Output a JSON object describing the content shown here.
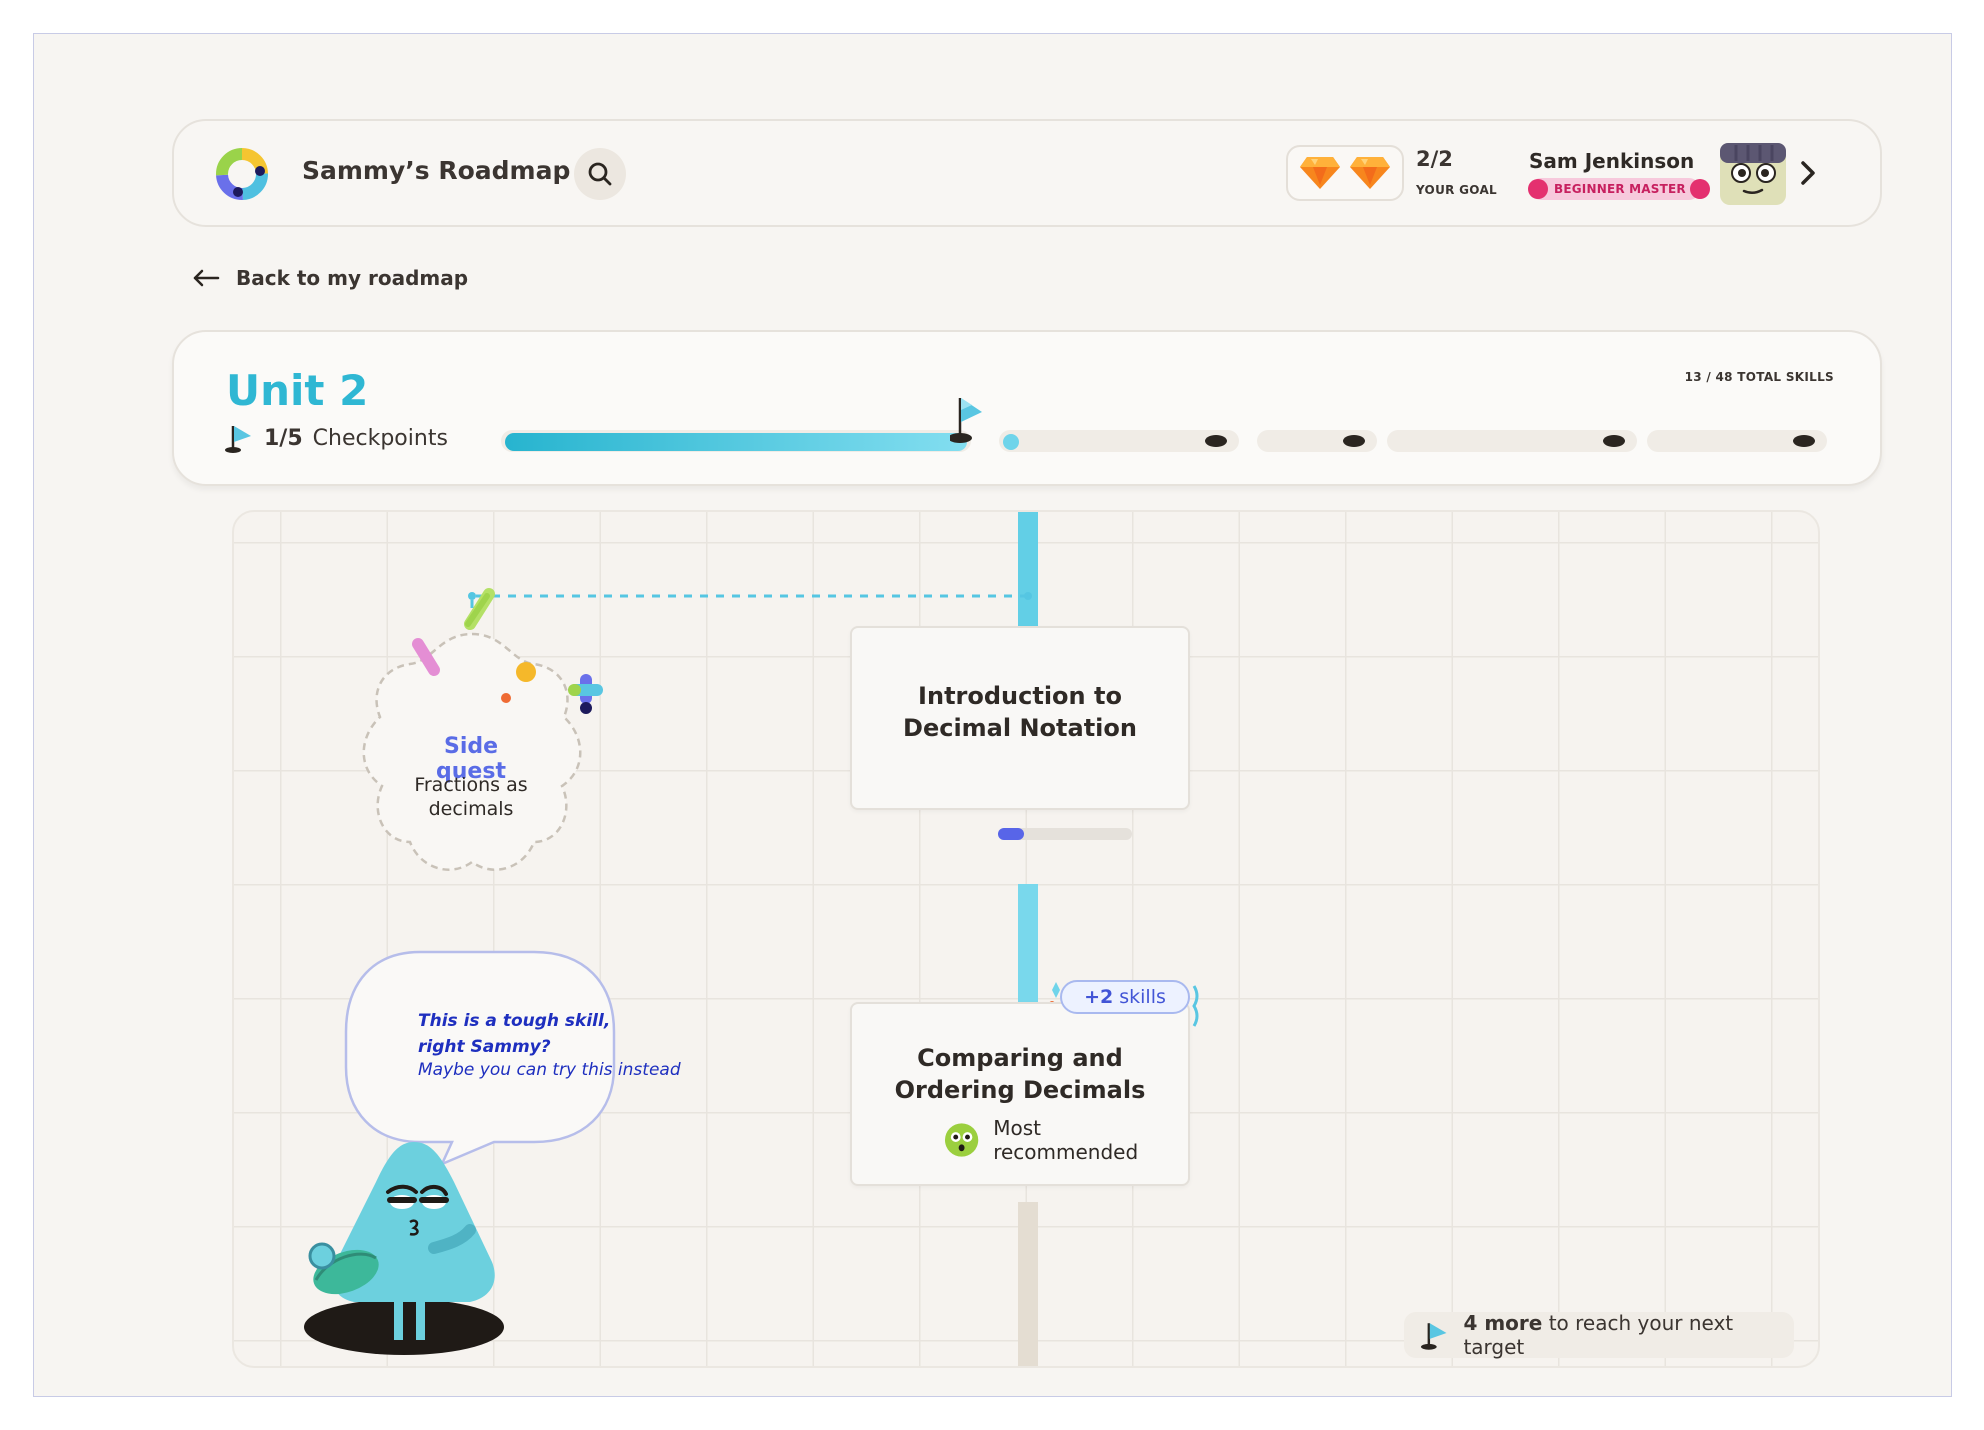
{
  "header": {
    "app_title": "Sammy’s Roadmap",
    "goal_count": "2/2",
    "goal_label": "YOUR GOAL",
    "user_name": "Sam Jenkinson",
    "rank_badge": "BEGINNER MASTER"
  },
  "nav": {
    "back_label": "Back to my roadmap"
  },
  "unit": {
    "title": "Unit 2",
    "checkpoints_count": "1/5",
    "checkpoints_label": "Checkpoints",
    "total_skills": "13 / 48 TOTAL SKILLS",
    "progress_fraction": 0.2
  },
  "map": {
    "side_quest": {
      "title": "Side quest",
      "subtitle": "Fractions as decimals"
    },
    "cards": [
      {
        "title": "Introduction to Decimal Notation",
        "progress_fraction": 0.2
      },
      {
        "title": "Comparing and Ordering Decimals",
        "badge": "Most recommended"
      }
    ],
    "extra_skills": {
      "count": "+2",
      "label": "skills"
    },
    "speech": {
      "line1": "This is a tough skill, right Sammy?",
      "line2": "Maybe you can try this instead"
    },
    "target": {
      "count": "4 more",
      "label": "to reach your next target"
    }
  },
  "colors": {
    "accent": "#2fb7d3",
    "side_quest": "#5a6ce6",
    "speech_text": "#1e2fbf",
    "rank_pink": "#e4306f",
    "mascot": "#6cd0de"
  },
  "icons": [
    "logo-icon",
    "search-icon",
    "gem-icon",
    "avatar",
    "chevron-right-icon",
    "arrow-left-icon",
    "flag-icon",
    "mascot",
    "recommend-face-icon"
  ]
}
